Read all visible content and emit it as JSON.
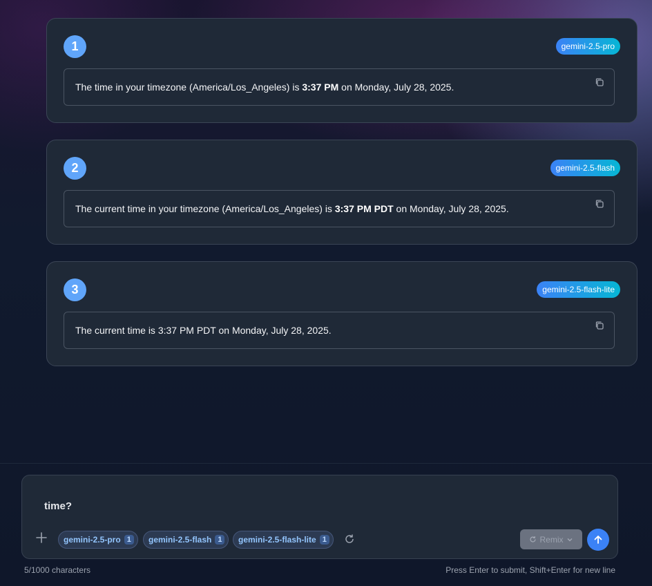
{
  "responses": [
    {
      "number": "1",
      "model": "gemini-2.5-pro",
      "text_before": "The time in your timezone (America/Los_Angeles) is ",
      "text_bold": "3:37 PM",
      "text_after": " on Monday, July 28, 2025."
    },
    {
      "number": "2",
      "model": "gemini-2.5-flash",
      "text_before": "The current time in your timezone (America/Los_Angeles) is ",
      "text_bold": "3:37 PM PDT",
      "text_after": " on Monday, July 28, 2025."
    },
    {
      "number": "3",
      "model": "gemini-2.5-flash-lite",
      "text_before": "The current time is 3:37 PM PDT on Monday, July 28, 2025.",
      "text_bold": "",
      "text_after": ""
    }
  ],
  "composer": {
    "input_value": "time?",
    "model_chips": [
      {
        "label": "gemini-2.5-pro",
        "count": "1"
      },
      {
        "label": "gemini-2.5-flash",
        "count": "1"
      },
      {
        "label": "gemini-2.5-flash-lite",
        "count": "1"
      }
    ],
    "remix_label": "Remix"
  },
  "footer": {
    "char_count": "5/1000 characters",
    "hint": "Press Enter to submit, Shift+Enter for new line"
  },
  "icons": {
    "copy": "copy-icon",
    "plus": "plus-icon",
    "refresh": "refresh-icon",
    "send": "arrow-up-icon",
    "remix": "refresh-icon",
    "chevron": "chevron-down-icon"
  },
  "colors": {
    "accent": "#3b82f6",
    "number_badge": "#60a5fa",
    "model_badge_from": "#3b82f6",
    "model_badge_to": "#06b6d4"
  }
}
